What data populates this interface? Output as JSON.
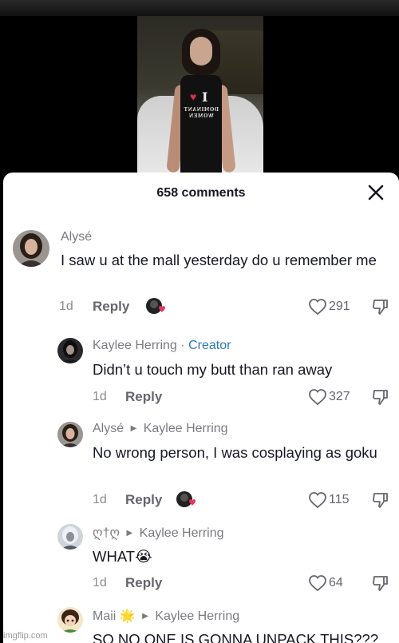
{
  "video": {
    "shirt_line1": "DOMINANT",
    "shirt_line2": "WOMEN"
  },
  "sheet": {
    "title": "658 comments"
  },
  "comments": [
    {
      "author": "Alysé",
      "text": "I saw u at the mall yesterday do u remember me",
      "time": "1d",
      "reply_label": "Reply",
      "likes": "291",
      "has_sticker": true
    },
    {
      "author": "Kaylee Herring",
      "badge": "Creator",
      "badge_sep": "·",
      "text": "Didn’t u touch my butt than ran away",
      "time": "1d",
      "reply_label": "Reply",
      "likes": "327"
    },
    {
      "author": "Alysé",
      "reply_to": "Kaylee Herring",
      "text": "No wrong person, I was cosplaying as goku",
      "time": "1d",
      "reply_label": "Reply",
      "likes": "115",
      "has_sticker": true
    },
    {
      "author": "ღ†ღ",
      "reply_to": "Kaylee Herring",
      "text": "WHAT😭",
      "time": "1d",
      "reply_label": "Reply",
      "likes": "64"
    },
    {
      "author": "Maii 🌟",
      "reply_to": "Kaylee Herring",
      "text": "SO NO ONE IS GONNA UNPACK THIS???"
    }
  ],
  "footer": {
    "watermark": "imgflip.com"
  },
  "colors": {
    "creator": "#2a7ab8",
    "text": "#161823",
    "muted": "#8a8b91",
    "heart_sticker": "#e8345c"
  }
}
